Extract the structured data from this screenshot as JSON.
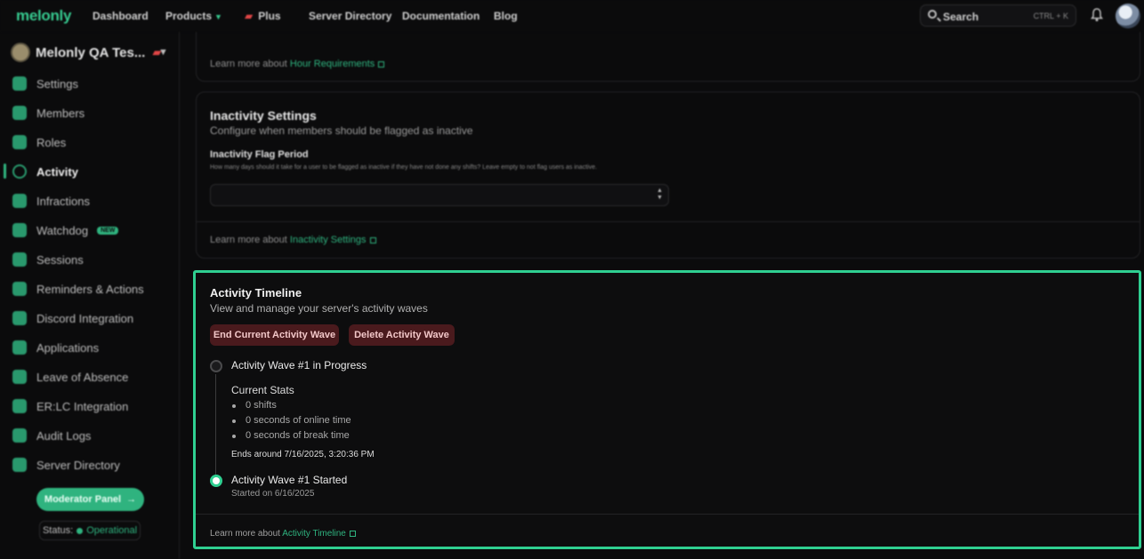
{
  "nav": {
    "logo": "melonly",
    "dashboard": "Dashboard",
    "products": "Products",
    "plus": "Plus",
    "server_directory": "Server Directory",
    "documentation": "Documentation",
    "blog": "Blog",
    "search_label": "Search",
    "search_shortcut": "CTRL + K"
  },
  "sidebar": {
    "server_name": "Melonly QA Tes...",
    "items": [
      {
        "label": "Settings"
      },
      {
        "label": "Members"
      },
      {
        "label": "Roles"
      },
      {
        "label": "Activity"
      },
      {
        "label": "Infractions"
      },
      {
        "label": "Watchdog",
        "badge": "NEW"
      },
      {
        "label": "Sessions"
      },
      {
        "label": "Reminders & Actions"
      },
      {
        "label": "Discord Integration"
      },
      {
        "label": "Applications"
      },
      {
        "label": "Leave of Absence"
      },
      {
        "label": "ER:LC Integration"
      },
      {
        "label": "Audit Logs"
      },
      {
        "label": "Server Directory"
      }
    ],
    "moderator_panel": "Moderator Panel",
    "status_label": "Status:",
    "status_value": "Operational"
  },
  "hour_req": {
    "learn_prefix": "Learn more about",
    "learn_link": "Hour Requirements"
  },
  "inactivity": {
    "title": "Inactivity Settings",
    "subtitle": "Configure when members should be flagged as inactive",
    "field_label": "Inactivity Flag Period",
    "field_desc": "How many days should it take for a user to be flagged as inactive if they have not done any shifts? Leave empty to not flag users as inactive.",
    "learn_prefix": "Learn more about",
    "learn_link": "Inactivity Settings"
  },
  "timeline": {
    "title": "Activity Timeline",
    "subtitle": "View and manage your server's activity waves",
    "end_button": "End Current Activity Wave",
    "delete_button": "Delete Activity Wave",
    "wave_progress": "Activity Wave #1 in Progress",
    "current_stats": "Current Stats",
    "stats": [
      "0 shifts",
      "0 seconds of online time",
      "0 seconds of break time"
    ],
    "ends": "Ends around 7/16/2025, 3:20:36 PM",
    "wave_started": "Activity Wave #1 Started",
    "started_on": "Started on 6/16/2025",
    "learn_prefix": "Learn more about",
    "learn_link": "Activity Timeline"
  },
  "colors": {
    "accent": "#2fcf91",
    "danger_bg": "#4a1a1d",
    "background": "#0b0b0c"
  }
}
